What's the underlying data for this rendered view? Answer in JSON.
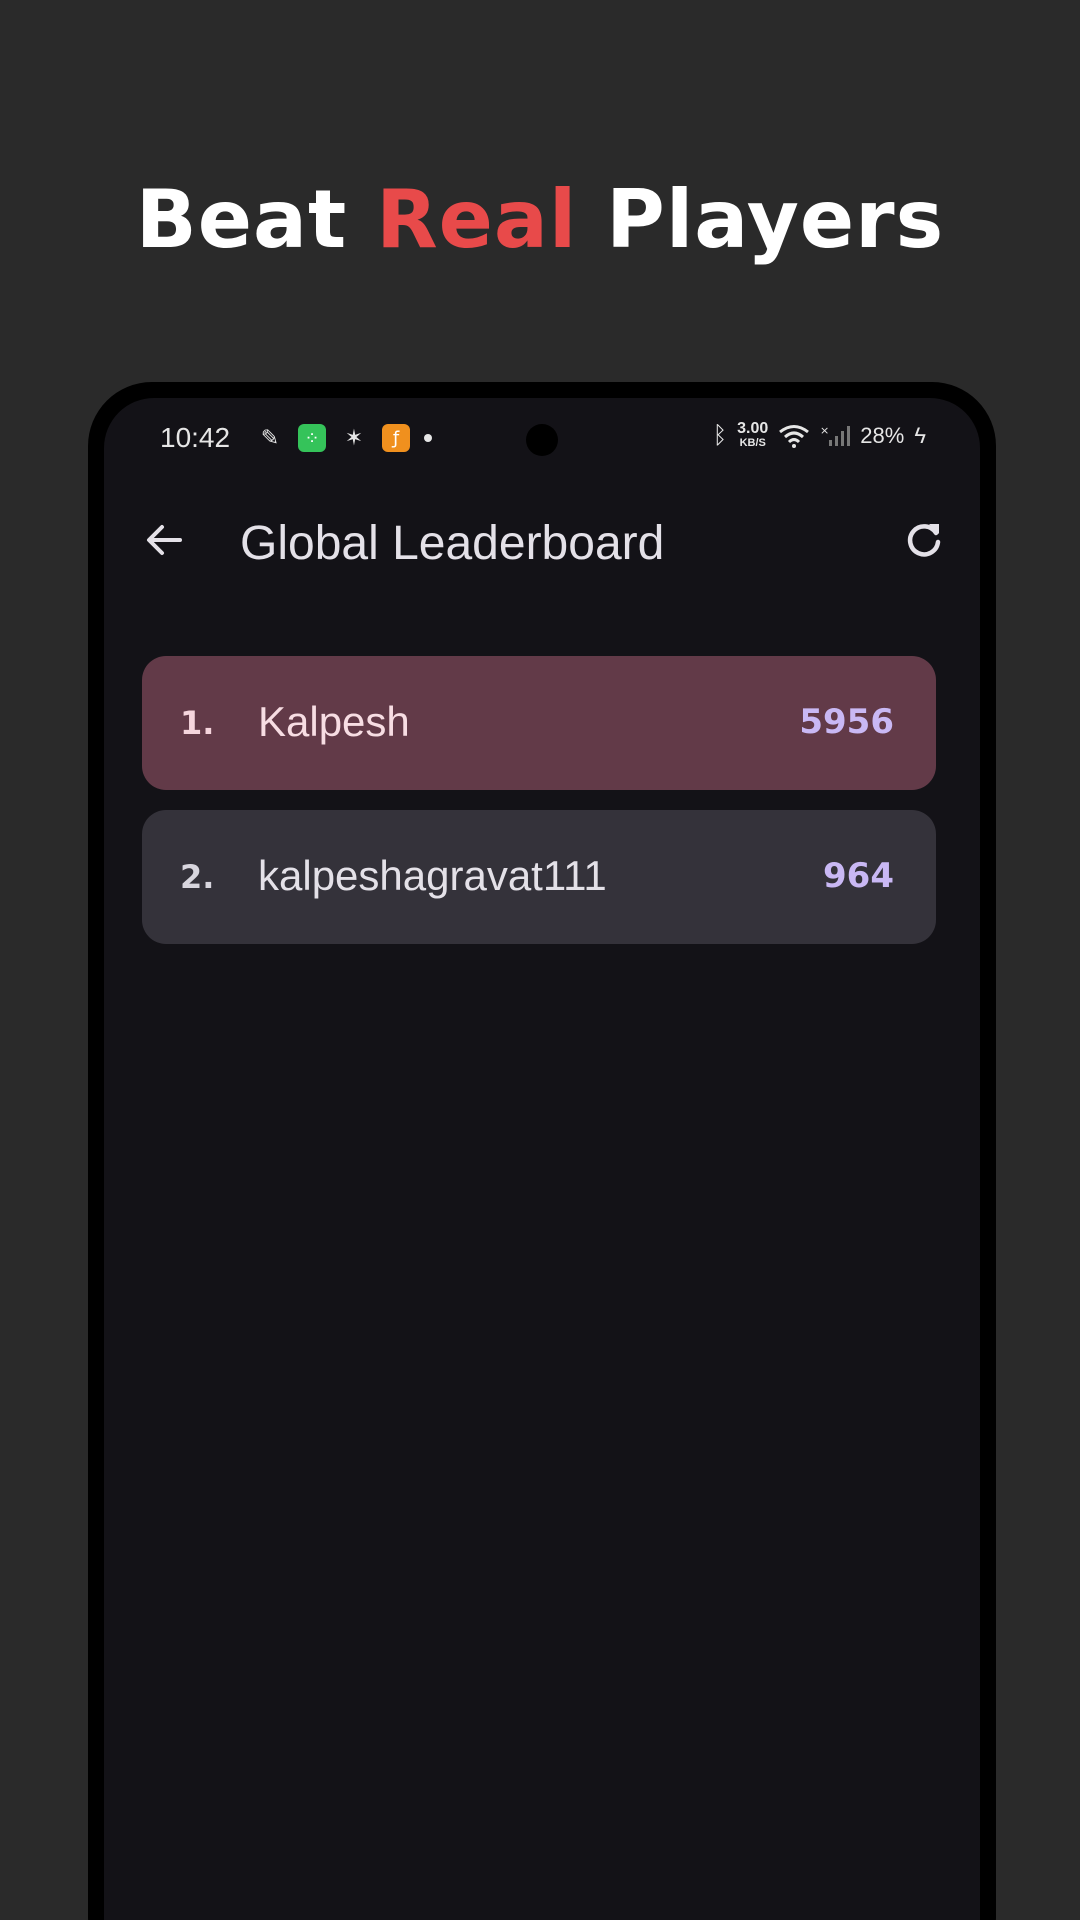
{
  "promo": {
    "heading_part1": "Beat ",
    "heading_accent": "Real",
    "heading_part2": " Players",
    "accent_color": "#e84a4a"
  },
  "status_bar": {
    "time": "10:42",
    "net_speed_value": "3.00",
    "net_speed_unit": "KB/S",
    "battery": "28%",
    "icons": [
      "chat-app-icon",
      "green-app-icon",
      "spark-icon",
      "orange-app-icon",
      "notification-dot",
      "bluetooth-icon",
      "wifi-icon",
      "signal-icon",
      "charging-icon"
    ]
  },
  "app_bar": {
    "title": "Global Leaderboard",
    "back_icon": "arrow-left-icon",
    "refresh_icon": "refresh-icon"
  },
  "leaderboard": [
    {
      "rank": "1.",
      "name": "Kalpesh",
      "score": "5956",
      "highlight": true
    },
    {
      "rank": "2.",
      "name": "kalpeshagravat111",
      "score": "964",
      "highlight": false
    }
  ],
  "colors": {
    "background": "#2a2a2a",
    "screen": "#131217",
    "top_row": "#623a48",
    "row": "#34323a",
    "score": "#c9b8f4"
  }
}
